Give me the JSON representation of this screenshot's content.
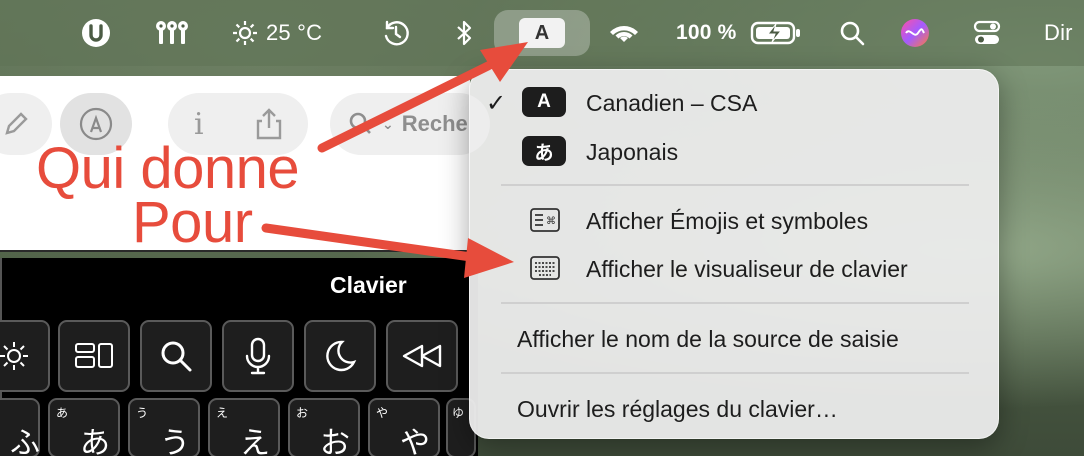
{
  "menubar": {
    "weather": "25 °C",
    "battery_percent": "100 %",
    "input_source_badge": "A",
    "clock_partial": "Dir",
    "icons": [
      "ublock-icon",
      "password-icon",
      "sun-icon",
      "time-machine-icon",
      "bluetooth-icon",
      "input-source-icon",
      "wifi-icon",
      "battery-icon",
      "search-icon",
      "siri-icon",
      "control-center-icon"
    ]
  },
  "app": {
    "search_placeholder": "Reche",
    "toolbar_icons": [
      "edit-icon",
      "markup-icon",
      "info-icon",
      "share-icon",
      "search-icon"
    ]
  },
  "keyboard_viewer": {
    "title": "Clavier",
    "function_keys": [
      "brightness-icon",
      "mission-control-icon",
      "spotlight-icon",
      "dictation-icon",
      "focus-icon",
      "rewind-icon"
    ],
    "kana_keys": [
      {
        "main": "ふ",
        "small": ""
      },
      {
        "main": "あ",
        "small": "あ"
      },
      {
        "main": "う",
        "small": "う"
      },
      {
        "main": "え",
        "small": "え"
      },
      {
        "main": "お",
        "small": "お"
      },
      {
        "main": "や",
        "small": "や"
      },
      {
        "main": "",
        "small": "ゆ"
      }
    ]
  },
  "annotations": {
    "line1": "Qui donne",
    "line2": "Pour",
    "color": "#e74c3c"
  },
  "menu": {
    "sources": [
      {
        "checked": "✓",
        "badge": "A",
        "label": "Canadien – CSA"
      },
      {
        "checked": "",
        "badge": "あ",
        "label": "Japonais"
      }
    ],
    "show_emoji": "Afficher Émojis et symboles",
    "show_keyboard_viewer": "Afficher le visualiseur de clavier",
    "show_source_name": "Afficher le nom de la source de saisie",
    "open_settings": "Ouvrir les réglages du clavier…"
  }
}
